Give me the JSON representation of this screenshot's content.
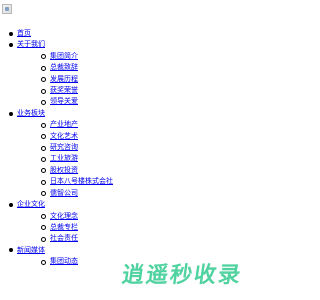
{
  "nav": {
    "items": [
      {
        "label": "首页",
        "children": []
      },
      {
        "label": "关于我们",
        "children": [
          "集团简介",
          "总裁致辞",
          "发展历程",
          "获奖荣誉",
          "领导关爱"
        ]
      },
      {
        "label": "业务板块",
        "children": [
          "产业地产",
          "文化艺术",
          "研究咨询",
          "工业旅游",
          "股权投资",
          "日本八号楼株式会社",
          "儒智公司"
        ]
      },
      {
        "label": "企业文化",
        "children": [
          "文化理念",
          "总裁专栏",
          "社会责任"
        ]
      },
      {
        "label": "新闻媒体",
        "children": [
          "集团动态"
        ]
      }
    ]
  },
  "watermark": {
    "text": "逍遥秒收录",
    "color": "#2bc88c"
  }
}
